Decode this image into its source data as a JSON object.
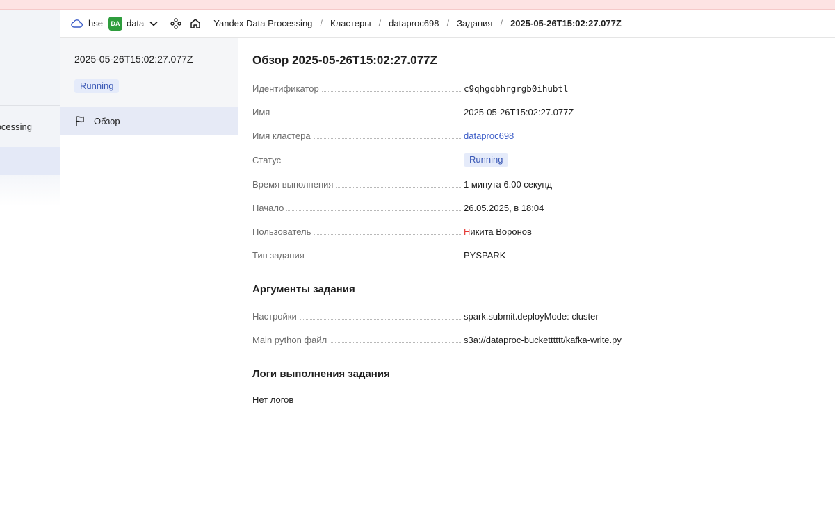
{
  "header": {
    "org": "hse",
    "folder_badge": "DA",
    "folder": "data",
    "breadcrumbs": [
      "Yandex Data Processing",
      "Кластеры",
      "dataproc698",
      "Задания",
      "2025-05-26T15:02:27.077Z"
    ],
    "separator": "/"
  },
  "left_nav": {
    "item_label_fragment": "ocessing"
  },
  "sidepanel": {
    "title": "2025-05-26T15:02:27.077Z",
    "status": "Running",
    "nav_overview": "Обзор"
  },
  "main": {
    "title": "Обзор 2025-05-26T15:02:27.077Z",
    "fields": [
      {
        "label": "Идентификатор",
        "value": "c9qhgqbhrgrgb0ihubtl"
      },
      {
        "label": "Имя",
        "value": "2025-05-26T15:02:27.077Z"
      },
      {
        "label": "Имя кластера",
        "value": "dataproc698"
      },
      {
        "label": "Статус",
        "value": "Running"
      },
      {
        "label": "Время выполнения",
        "value": "1 минута 6.00 секунд"
      },
      {
        "label": "Начало",
        "value": "26.05.2025, в 18:04"
      },
      {
        "label": "Пользователь",
        "value_first_letter": "Н",
        "value_rest": "икита Воронов"
      },
      {
        "label": "Тип задания",
        "value": "PYSPARK"
      }
    ],
    "args_title": "Аргументы задания",
    "args": [
      {
        "label": "Настройки",
        "value": "spark.submit.deployMode: cluster"
      },
      {
        "label": "Main python файл",
        "value": "s3a://dataproc-bucketttttt/kafka-write.py"
      }
    ],
    "logs_title": "Логи выполнения задания",
    "logs_empty": "Нет логов"
  },
  "colors": {
    "banner": "#fde3e3",
    "accent_link": "#3a5bc7",
    "status_bg": "#e5ebfa",
    "status_text": "#3b59b6",
    "badge_green": "#2e9d3d",
    "selected_nav": "#e6eaf6"
  }
}
